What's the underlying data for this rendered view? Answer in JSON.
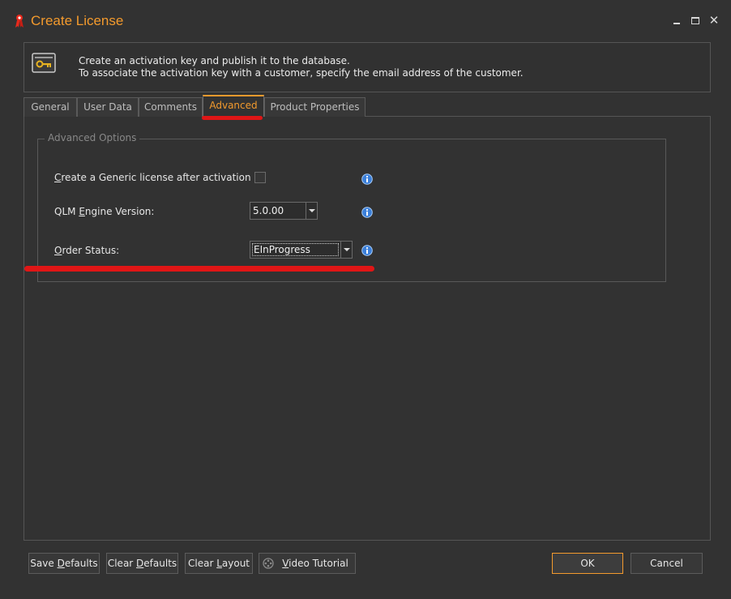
{
  "window": {
    "title": "Create License",
    "icon": "ribbon-icon",
    "controls": [
      "minimize-icon",
      "maximize-icon",
      "close-icon"
    ],
    "close_glyph": "✕"
  },
  "header": {
    "line1": "Create an activation key and publish it to the database.",
    "line2": "To associate the activation key with a customer, specify the email address of the customer.",
    "icon": "key-icon"
  },
  "tabs": [
    {
      "label": "General"
    },
    {
      "label": "User Data"
    },
    {
      "label": "Comments"
    },
    {
      "label": "Advanced",
      "active": true
    },
    {
      "label": "Product Properties"
    }
  ],
  "advanced": {
    "group_title": "Advanced Options",
    "generic_license": {
      "label_first": "C",
      "label_rest": "reate a Generic license after activation",
      "checked": false
    },
    "engine_version": {
      "label_pre": "QLM ",
      "label_u": "E",
      "label_post": "ngine Version:",
      "value": "5.0.00"
    },
    "order_status": {
      "label_first": "O",
      "label_rest": "rder Status:",
      "value": "EInProgress"
    }
  },
  "buttons": {
    "save_defaults": {
      "pre": "Save ",
      "u": "D",
      "post": "efaults"
    },
    "clear_defaults": {
      "pre": "Clear ",
      "u": "D",
      "post": "efaults"
    },
    "clear_layout": {
      "pre": "Clear ",
      "u": "L",
      "post": "ayout"
    },
    "video_tutorial": {
      "u": "V",
      "post": "ideo Tutorial"
    },
    "ok": "OK",
    "cancel": "Cancel"
  },
  "colors": {
    "accent": "#f39a2d",
    "highlight_underline": "#e01616",
    "background": "#323232"
  }
}
